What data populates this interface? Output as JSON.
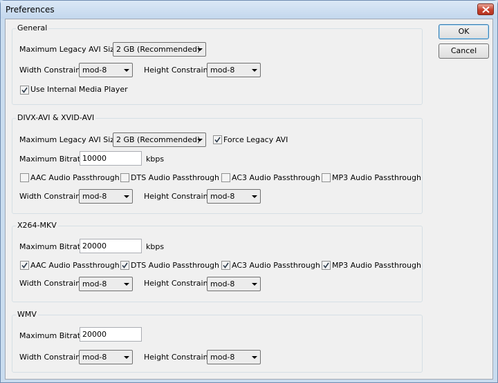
{
  "window": {
    "title": "Preferences"
  },
  "buttons": {
    "ok": "OK",
    "cancel": "Cancel"
  },
  "general": {
    "title": "General",
    "avi_size_label": "Maximum Legacy AVI Size",
    "avi_size_value": "2 GB (Recommended)",
    "width_label": "Width Constraint",
    "width_value": "mod-8",
    "height_label": "Height Constraint",
    "height_value": "mod-8",
    "internal_player_label": "Use Internal Media Player",
    "internal_player_checked": true
  },
  "divx": {
    "title": "DIVX-AVI & XVID-AVI",
    "avi_size_label": "Maximum Legacy AVI Size",
    "avi_size_value": "2 GB (Recommended)",
    "force_legacy_label": "Force Legacy AVI",
    "force_legacy_checked": true,
    "bitrate_label": "Maximum Bitrate",
    "bitrate_value": "10000",
    "bitrate_unit": "kbps",
    "passthrough": [
      {
        "label": "AAC Audio Passthrough",
        "checked": false
      },
      {
        "label": "DTS Audio Passthrough",
        "checked": false
      },
      {
        "label": "AC3 Audio Passthrough",
        "checked": false
      },
      {
        "label": "MP3 Audio Passthrough",
        "checked": false
      }
    ],
    "width_label": "Width Constraint",
    "width_value": "mod-8",
    "height_label": "Height Constraint",
    "height_value": "mod-8"
  },
  "x264": {
    "title": "X264-MKV",
    "bitrate_label": "Maximum Bitrate",
    "bitrate_value": "20000",
    "bitrate_unit": "kbps",
    "passthrough": [
      {
        "label": "AAC Audio Passthrough",
        "checked": true
      },
      {
        "label": "DTS Audio Passthrough",
        "checked": true
      },
      {
        "label": "AC3 Audio Passthrough",
        "checked": true
      },
      {
        "label": "MP3 Audio Passthrough",
        "checked": true
      }
    ],
    "width_label": "Width Constraint",
    "width_value": "mod-8",
    "height_label": "Height Constraint",
    "height_value": "mod-8"
  },
  "wmv": {
    "title": "WMV",
    "bitrate_label": "Maximum Bitrate",
    "bitrate_value": "20000",
    "width_label": "Width Constraint",
    "width_value": "mod-8",
    "height_label": "Height Constraint",
    "height_value": "mod-8"
  }
}
